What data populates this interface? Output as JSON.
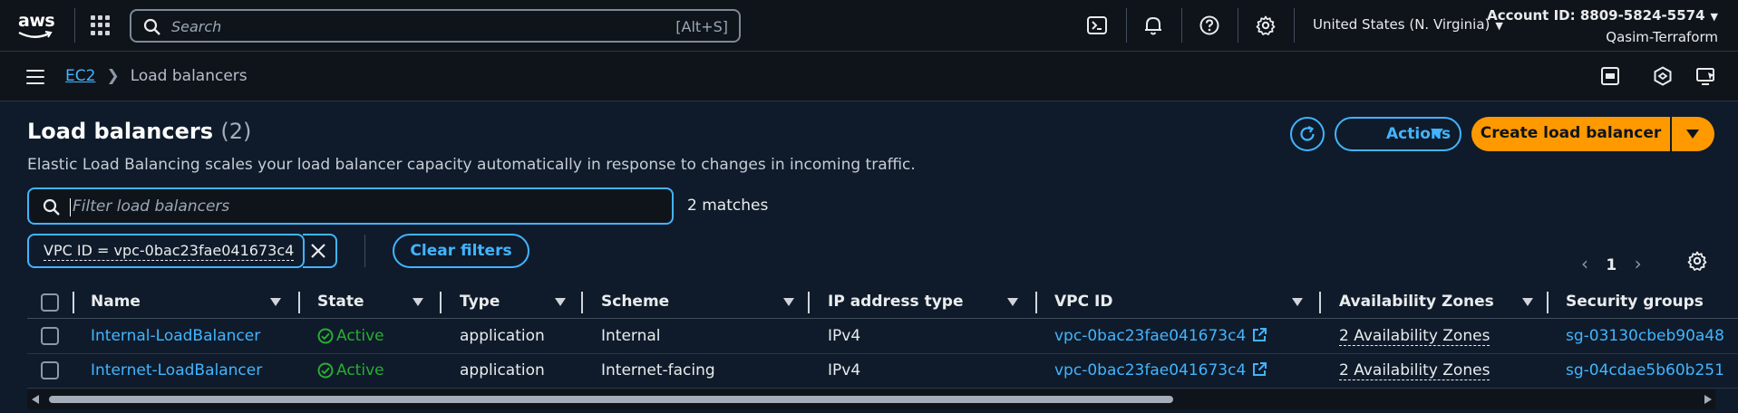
{
  "topnav": {
    "logo_text": "aws",
    "search_placeholder": "Search",
    "search_shortcut": "[Alt+S]",
    "region": "United States (N. Virginia)",
    "account_id": "Account ID: 8809-5824-5574",
    "account_name": "Qasim-Terraform",
    "icons": [
      "cloudshell-icon",
      "bell-icon",
      "help-icon",
      "gear-icon"
    ]
  },
  "breadcrumb": {
    "parent": "EC2",
    "current": "Load balancers"
  },
  "page": {
    "title": "Load balancers",
    "count": "(2)",
    "description": "Elastic Load Balancing scales your load balancer capacity automatically in response to changes in incoming traffic.",
    "actions_label": "Actions",
    "create_label": "Create load balancer",
    "filter_placeholder": "Filter load balancers",
    "matches": "2 matches",
    "token": "VPC ID = vpc-0bac23fae041673c4",
    "clear_filters": "Clear filters",
    "page_number": "1"
  },
  "colors": {
    "accent": "#42b4ff",
    "primary_button": "#ff9900",
    "status_active": "#29ad32"
  },
  "table": {
    "columns": [
      "Name",
      "State",
      "Type",
      "Scheme",
      "IP address type",
      "VPC ID",
      "Availability Zones",
      "Security groups"
    ],
    "rows": [
      {
        "name": "Internal-LoadBalancer",
        "state": "Active",
        "type": "application",
        "scheme": "Internal",
        "ip_type": "IPv4",
        "vpc": "vpc-0bac23fae041673c4",
        "azs": "2 Availability Zones",
        "sg": "sg-03130cbeb90a48"
      },
      {
        "name": "Internet-LoadBalancer",
        "state": "Active",
        "type": "application",
        "scheme": "Internet-facing",
        "ip_type": "IPv4",
        "vpc": "vpc-0bac23fae041673c4",
        "azs": "2 Availability Zones",
        "sg": "sg-04cdae5b60b251"
      }
    ]
  }
}
